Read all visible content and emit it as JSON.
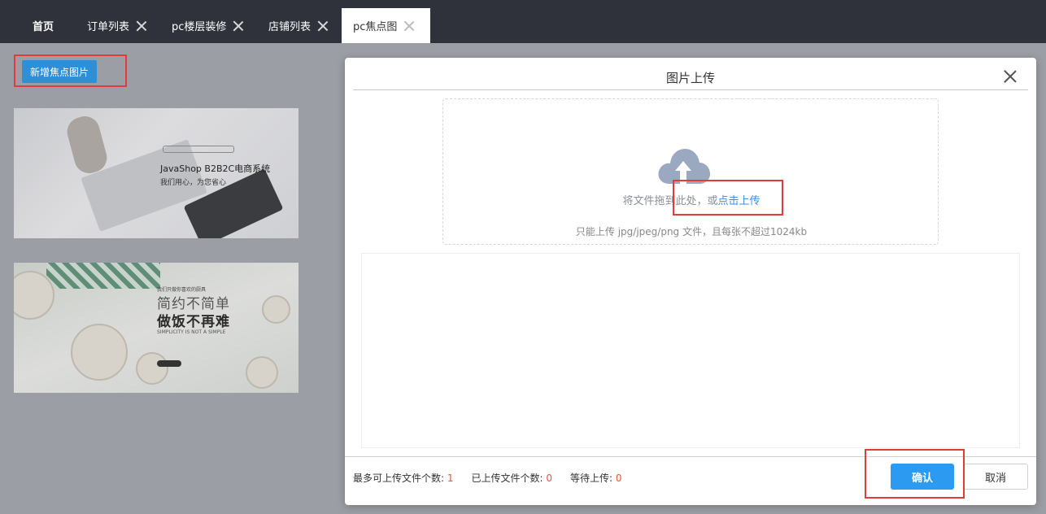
{
  "tabs": [
    {
      "label": "首页",
      "closable": false,
      "active": false
    },
    {
      "label": "订单列表",
      "closable": true,
      "active": false
    },
    {
      "label": "pc楼层装修",
      "closable": true,
      "active": false
    },
    {
      "label": "店铺列表",
      "closable": true,
      "active": false
    },
    {
      "label": "pc焦点图",
      "closable": true,
      "active": true
    }
  ],
  "page": {
    "add_button_label": "新增焦点图片",
    "banners": [
      {
        "line1": "JavaShop B2B2C电商系统",
        "line2": "我们用心，为您省心"
      },
      {
        "small": "我们只做你喜欢的厨具",
        "line1": "简约不简单",
        "line2": "做饭不再难",
        "tiny": "SIMPLICITY IS NOT A SIMPLE"
      }
    ]
  },
  "modal": {
    "title": "图片上传",
    "drop_text_prefix": "将文件拖到此处，或",
    "drop_text_link": "点击上传",
    "drop_tip": "只能上传 jpg/jpeg/png 文件，且每张不超过1024kb",
    "stats": {
      "max_label": "最多可上传文件个数:",
      "max_value": "1",
      "uploaded_label": "已上传文件个数:",
      "uploaded_value": "0",
      "waiting_label": "等待上传:",
      "waiting_value": "0"
    },
    "confirm_label": "确认",
    "cancel_label": "取消"
  },
  "colors": {
    "tabbar_bg": "#2f323b",
    "primary": "#2d9af1",
    "highlight_box": "#e23b3b",
    "stat_number": "#e6553a"
  },
  "icons": [
    "close-icon",
    "upload-cloud-icon"
  ]
}
